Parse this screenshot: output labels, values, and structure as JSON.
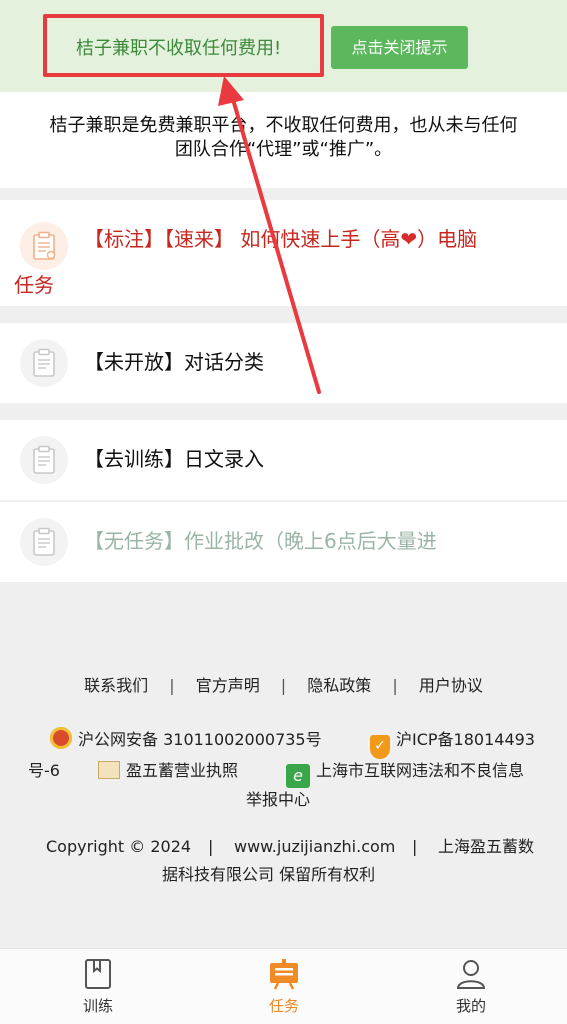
{
  "notice": {
    "text": "桔子兼职不收取任何费用!",
    "close_button": "点击关闭提示"
  },
  "disclaimer": {
    "line1": "桔子兼职是免费兼职平台，不收取任何费用，也从未与任何",
    "line2": "团队合作“代理”或“推广”。"
  },
  "tasks": [
    {
      "line1_a": "【标注】【速来】 如何快速上手（高",
      "heart": "❤",
      "line1_b": "）电脑",
      "line2": "任务"
    },
    {
      "title": "【未开放】对话分类"
    },
    {
      "title": "【去训练】日文录入"
    },
    {
      "title": "【无任务】作业批改（晚上6点后大量进"
    }
  ],
  "footer": {
    "links": [
      "联系我们",
      "官方声明",
      "隐私政策",
      "用户协议"
    ],
    "separator": "|",
    "police_beian": "沪公网安备 31011002000735号",
    "icp_part1": "沪ICP备18014493",
    "icp_part2": "号-6",
    "license": "盈五蓄营业执照",
    "report_part1": "上海市互联网违法和不良信息",
    "report_part2": "举报中心",
    "copyright_part1": "Copyright © 2024",
    "site": "www.juzijianzhi.com",
    "company_part1": "上海盈五蓄数",
    "company_part2": "据科技有限公司 保留所有权利"
  },
  "tabbar": {
    "train": "训练",
    "task": "任务",
    "mine": "我的"
  },
  "colors": {
    "accent_green": "#5cb85c",
    "highlight_red": "#e83a3f",
    "task_red": "#c7271f",
    "active_tab": "#f08a24",
    "disabled_task": "#9ab5a6"
  }
}
